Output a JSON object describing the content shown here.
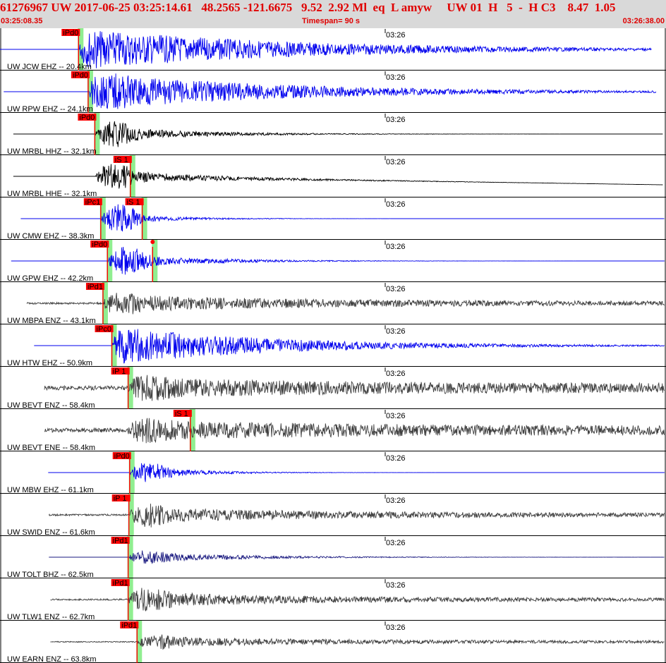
{
  "header": {
    "title": "61276967 UW 2017-06-25 03:25:14.61   48.2565 -121.6675   9.52  2.92 Ml  eq  L amyw     UW 01  H   5  -  H C3    8.47  1.05",
    "start_time": "03:25:08.35",
    "timespan": "Timespan=  90 s",
    "end_time": "03:26:38.00"
  },
  "chart_data": {
    "type": "line",
    "minute_tick_label": "03:26",
    "minute_tick_seconds": 52,
    "x_range_seconds": [
      0,
      90
    ],
    "colors": {
      "blue": "#0000ee",
      "black": "#000000",
      "gray": "#404040",
      "navy": "#1a1a80",
      "pick": "#ff0000",
      "pick_window": "#90ee90"
    },
    "traces": [
      {
        "label": "UW JCW EHZ -- 20.4km",
        "color": "blue",
        "data_start": 0,
        "data_end": 88.0,
        "onset": 10.6,
        "amp": 1.0,
        "peak": 1.0,
        "decay": 28,
        "noise": 0.0,
        "picks": [
          {
            "label": "iPd0",
            "t": 10.6
          }
        ]
      },
      {
        "label": "UW RPW EHZ -- 24.1km",
        "color": "blue",
        "data_start": 0.5,
        "data_end": 88.6,
        "onset": 11.9,
        "amp": 0.9,
        "peak": 1.0,
        "decay": 26,
        "noise": 0.0,
        "picks": [
          {
            "label": "iPd0",
            "t": 11.9
          }
        ]
      },
      {
        "label": "UW MRBL HHZ -- 32.1km",
        "color": "black",
        "data_start": 1.8,
        "data_end": 89.5,
        "onset": 12.8,
        "amp": 0.4,
        "peak": 0.8,
        "decay": 12,
        "noise": 0.0,
        "picks": [
          {
            "label": "iPd0",
            "t": 12.8
          }
        ]
      },
      {
        "label": "UW MRBL HHE -- 32.1km",
        "color": "black",
        "data_start": 1.8,
        "data_end": 89.5,
        "onset": 12.8,
        "amp": 0.35,
        "peak": 0.8,
        "decay": 15,
        "noise": 0.0,
        "drift": 0.2,
        "picks": [
          {
            "label": "iS 1",
            "t": 17.6
          }
        ]
      },
      {
        "label": "UW CMW EHZ -- 38.3km",
        "color": "blue",
        "data_start": 2.8,
        "data_end": 90.5,
        "onset": 13.6,
        "amp": 0.3,
        "peak": 1.0,
        "decay": 8,
        "noise": 0.0,
        "picks": [
          {
            "label": "iPc1",
            "t": 13.6
          },
          {
            "label": "iS 1",
            "t": 19.2
          }
        ]
      },
      {
        "label": "UW GPW EHZ -- 42.2km",
        "color": "blue",
        "data_start": 1.5,
        "data_end": 91.0,
        "onset": 14.5,
        "amp": 0.35,
        "peak": 0.9,
        "decay": 12,
        "noise": 0.0,
        "picks": [
          {
            "label": "iPd0",
            "t": 14.5
          },
          {
            "label": "",
            "t": 20.6
          }
        ]
      },
      {
        "label": "UW MBPA ENZ -- 43.1km",
        "color": "gray",
        "data_start": 3.6,
        "data_end": 91.2,
        "onset": 13.9,
        "amp": 0.35,
        "peak": 0.55,
        "decay": 25,
        "noise": 0.09,
        "picks": [
          {
            "label": "iPd1",
            "t": 13.9
          }
        ]
      },
      {
        "label": "UW HTW EHZ -- 50.9km",
        "color": "blue",
        "data_start": 4.6,
        "data_end": 92.2,
        "onset": 15.1,
        "amp": 0.9,
        "peak": 1.0,
        "decay": 22,
        "noise": 0.0,
        "picks": [
          {
            "label": "iPc0",
            "t": 15.1
          }
        ]
      },
      {
        "label": "UW BEVT ENZ -- 58.4km",
        "color": "gray",
        "data_start": 6.0,
        "data_end": 93.6,
        "onset": 17.3,
        "amp": 0.3,
        "peak": 0.5,
        "decay": 30,
        "noise": 0.2,
        "picks": [
          {
            "label": "iP 1",
            "t": 17.3
          }
        ]
      },
      {
        "label": "UW BEVT ENE -- 58.4km",
        "color": "gray",
        "data_start": 6.0,
        "data_end": 93.6,
        "onset": 17.3,
        "amp": 0.3,
        "peak": 0.5,
        "decay": 30,
        "noise": 0.2,
        "picks": [
          {
            "label": "iS 1",
            "t": 25.7
          }
        ]
      },
      {
        "label": "UW MBW EHZ -- 61.1km",
        "color": "blue",
        "data_start": 6.5,
        "data_end": 94.5,
        "onset": 17.5,
        "amp": 0.35,
        "peak": 0.7,
        "decay": 8,
        "noise": 0.0,
        "picks": [
          {
            "label": "iPd0",
            "t": 17.5
          }
        ]
      },
      {
        "label": "UW SWID ENZ -- 61.6km",
        "color": "gray",
        "data_start": 6.6,
        "data_end": 94.5,
        "onset": 17.4,
        "amp": 0.3,
        "peak": 0.6,
        "decay": 25,
        "noise": 0.08,
        "picks": [
          {
            "label": "iP 1",
            "t": 17.4
          }
        ]
      },
      {
        "label": "UW TOLT BHZ -- 62.5km",
        "color": "navy",
        "data_start": 6.6,
        "data_end": 94.5,
        "onset": 17.3,
        "amp": 0.25,
        "peak": 0.4,
        "decay": 15,
        "noise": 0.0,
        "picks": [
          {
            "label": "iPd1",
            "t": 17.3
          }
        ]
      },
      {
        "label": "UW TLW1 ENZ -- 62.7km",
        "color": "gray",
        "data_start": 6.8,
        "data_end": 94.5,
        "onset": 17.3,
        "amp": 0.35,
        "peak": 0.6,
        "decay": 20,
        "noise": 0.07,
        "picks": [
          {
            "label": "iPd1",
            "t": 17.3
          }
        ]
      },
      {
        "label": "UW EARN ENZ -- 63.8km",
        "color": "gray",
        "data_start": 6.8,
        "data_end": 94.5,
        "onset": 18.5,
        "amp": 0.2,
        "peak": 0.35,
        "decay": 25,
        "noise": 0.05,
        "picks": [
          {
            "label": "iPd1",
            "t": 18.5
          }
        ]
      }
    ]
  }
}
